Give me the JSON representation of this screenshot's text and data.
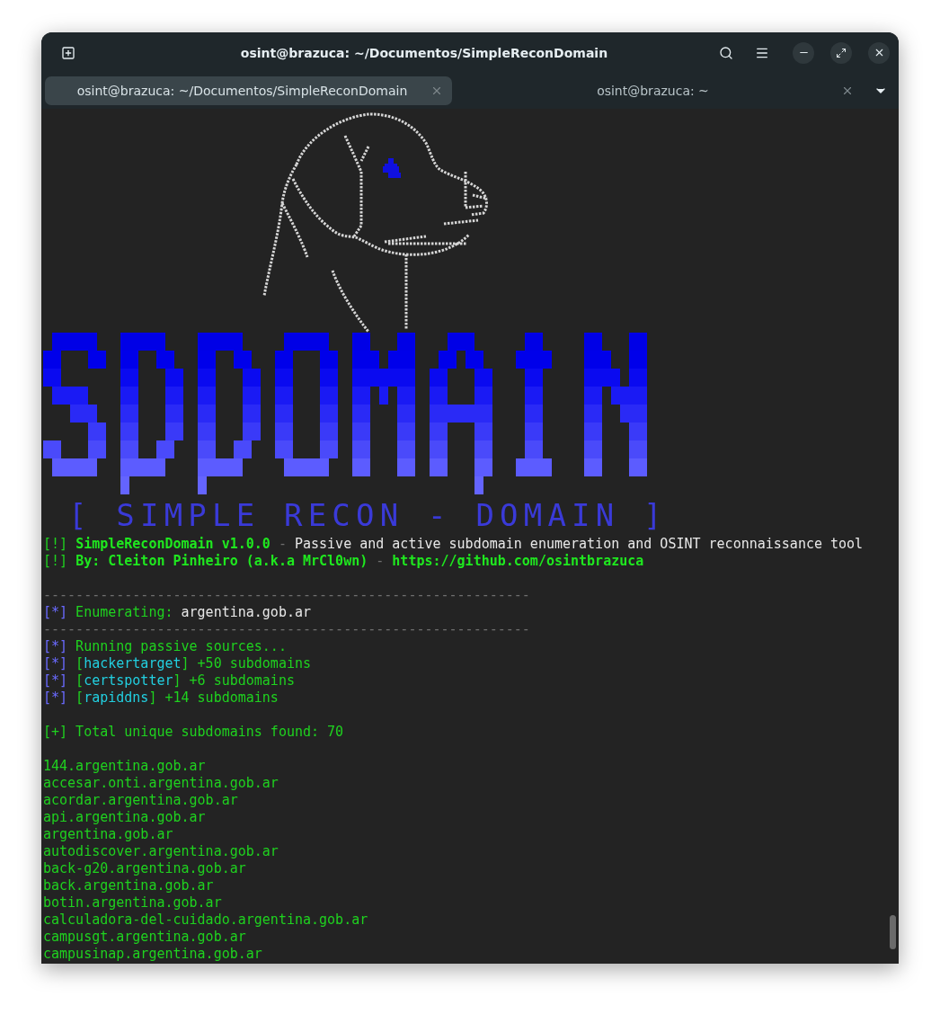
{
  "window": {
    "title": "osint@brazuca: ~/Documentos/SimpleReconDomain"
  },
  "tabs": [
    {
      "label": "osint@brazuca: ~/Documentos/SimpleReconDomain",
      "selected": true
    },
    {
      "label": "osint@brazuca: ~",
      "selected": false
    }
  ],
  "terminal": {
    "banner": "[ SIMPLE RECON - DOMAIN ]",
    "lines": [
      {
        "kind": "text",
        "segments": [
          {
            "kind": "mark-green",
            "text": "[!] "
          },
          {
            "kind": "bold",
            "text": "SimpleReconDomain v1.0.0"
          },
          {
            "kind": "dim",
            "text": " - "
          },
          {
            "kind": "white",
            "text": "Passive and active subdomain enumeration and OSINT reconnaissance tool"
          }
        ]
      },
      {
        "kind": "text",
        "segments": [
          {
            "kind": "mark-green",
            "text": "[!] "
          },
          {
            "kind": "bold",
            "text": "By: Cleiton Pinheiro (a.k.a MrCl0wn)"
          },
          {
            "kind": "dim",
            "text": " - "
          },
          {
            "kind": "bold",
            "text": "https://github.com/osintbrazuca"
          }
        ]
      },
      {
        "kind": "blank"
      },
      {
        "kind": "text",
        "segments": [
          {
            "kind": "dim",
            "text": "------------------------------------------------------------"
          }
        ]
      },
      {
        "kind": "text",
        "segments": [
          {
            "kind": "mark-blue",
            "text": "[*]"
          },
          {
            "kind": "green",
            "text": " Enumerating: "
          },
          {
            "kind": "white",
            "text": "argentina.gob.ar"
          }
        ]
      },
      {
        "kind": "text",
        "segments": [
          {
            "kind": "dim",
            "text": "------------------------------------------------------------"
          }
        ]
      },
      {
        "kind": "text",
        "segments": [
          {
            "kind": "mark-blue",
            "text": "[*]"
          },
          {
            "kind": "green",
            "text": " Running passive sources..."
          }
        ]
      },
      {
        "kind": "text",
        "segments": [
          {
            "kind": "mark-blue",
            "text": "[*]"
          },
          {
            "kind": "green",
            "text": " ["
          },
          {
            "kind": "cyan",
            "text": "hackertarget"
          },
          {
            "kind": "green",
            "text": "] +50 subdomains"
          }
        ]
      },
      {
        "kind": "text",
        "segments": [
          {
            "kind": "mark-blue",
            "text": "[*]"
          },
          {
            "kind": "green",
            "text": " ["
          },
          {
            "kind": "cyan",
            "text": "certspotter"
          },
          {
            "kind": "green",
            "text": "] +6 subdomains"
          }
        ]
      },
      {
        "kind": "text",
        "segments": [
          {
            "kind": "mark-blue",
            "text": "[*]"
          },
          {
            "kind": "green",
            "text": " ["
          },
          {
            "kind": "cyan",
            "text": "rapiddns"
          },
          {
            "kind": "green",
            "text": "] +14 subdomains"
          }
        ]
      },
      {
        "kind": "blank"
      },
      {
        "kind": "text",
        "segments": [
          {
            "kind": "green",
            "text": "[+] Total unique subdomains found: 70"
          }
        ]
      },
      {
        "kind": "blank"
      },
      {
        "kind": "text",
        "segments": [
          {
            "kind": "green",
            "text": "144.argentina.gob.ar"
          }
        ]
      },
      {
        "kind": "text",
        "segments": [
          {
            "kind": "green",
            "text": "accesar.onti.argentina.gob.ar"
          }
        ]
      },
      {
        "kind": "text",
        "segments": [
          {
            "kind": "green",
            "text": "acordar.argentina.gob.ar"
          }
        ]
      },
      {
        "kind": "text",
        "segments": [
          {
            "kind": "green",
            "text": "api.argentina.gob.ar"
          }
        ]
      },
      {
        "kind": "text",
        "segments": [
          {
            "kind": "green",
            "text": "argentina.gob.ar"
          }
        ]
      },
      {
        "kind": "text",
        "segments": [
          {
            "kind": "green",
            "text": "autodiscover.argentina.gob.ar"
          }
        ]
      },
      {
        "kind": "text",
        "segments": [
          {
            "kind": "green",
            "text": "back-g20.argentina.gob.ar"
          }
        ]
      },
      {
        "kind": "text",
        "segments": [
          {
            "kind": "green",
            "text": "back.argentina.gob.ar"
          }
        ]
      },
      {
        "kind": "text",
        "segments": [
          {
            "kind": "green",
            "text": "botin.argentina.gob.ar"
          }
        ]
      },
      {
        "kind": "text",
        "segments": [
          {
            "kind": "green",
            "text": "calculadora-del-cuidado.argentina.gob.ar"
          }
        ]
      },
      {
        "kind": "text",
        "segments": [
          {
            "kind": "green",
            "text": "campusgt.argentina.gob.ar"
          }
        ]
      },
      {
        "kind": "text",
        "segments": [
          {
            "kind": "green",
            "text": "campusinap.argentina.gob.ar"
          }
        ]
      }
    ]
  }
}
